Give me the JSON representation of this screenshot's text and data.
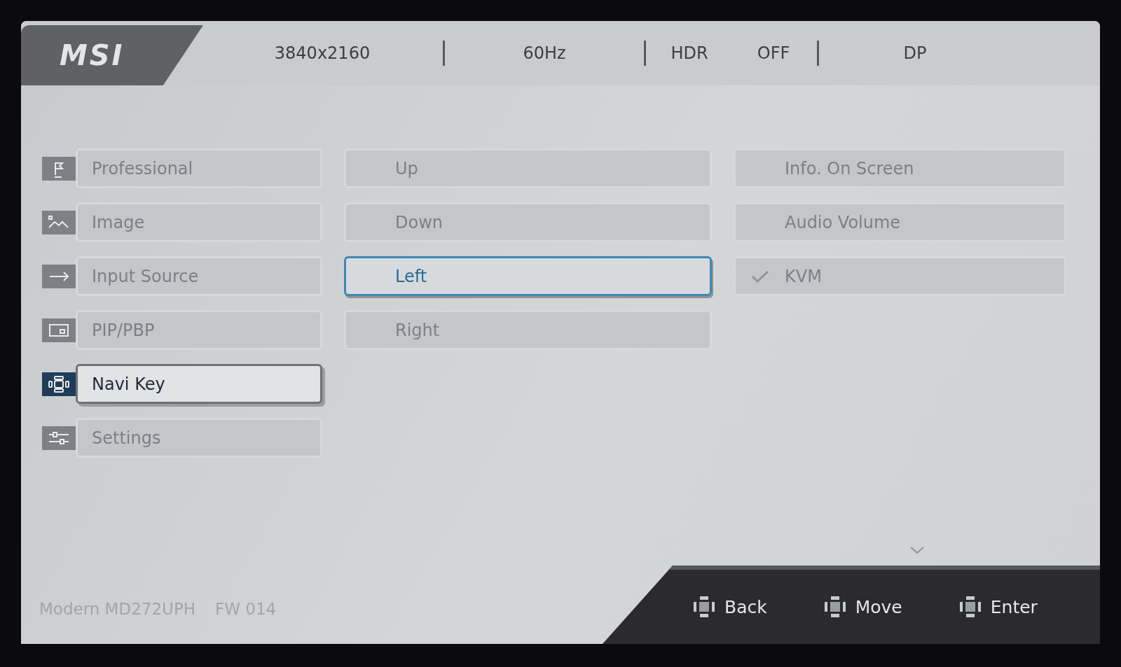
{
  "header": {
    "logo": "MSI",
    "status": [
      "3840x2160",
      "60Hz",
      "HDR",
      "OFF",
      "DP"
    ]
  },
  "menu": [
    {
      "label": "Professional",
      "kind": "flag",
      "selected": false
    },
    {
      "label": "Image",
      "kind": "image",
      "selected": false
    },
    {
      "label": "Input Source",
      "kind": "arrow",
      "selected": false
    },
    {
      "label": "PIP/PBP",
      "kind": "pip",
      "selected": false
    },
    {
      "label": "Navi Key",
      "kind": "dpad",
      "selected": true
    },
    {
      "label": "Settings",
      "kind": "sliders",
      "selected": false
    }
  ],
  "directions": [
    {
      "label": "Up",
      "selected": false
    },
    {
      "label": "Down",
      "selected": false
    },
    {
      "label": "Left",
      "selected": true
    },
    {
      "label": "Right",
      "selected": false
    }
  ],
  "options": [
    {
      "label": "Info. On Screen",
      "checked": false
    },
    {
      "label": "Audio Volume",
      "checked": false
    },
    {
      "label": "KVM",
      "checked": true
    }
  ],
  "footer": {
    "model": "Modern MD272UPH",
    "firmware": "FW  014",
    "hints": [
      "Back",
      "Move",
      "Enter"
    ]
  }
}
